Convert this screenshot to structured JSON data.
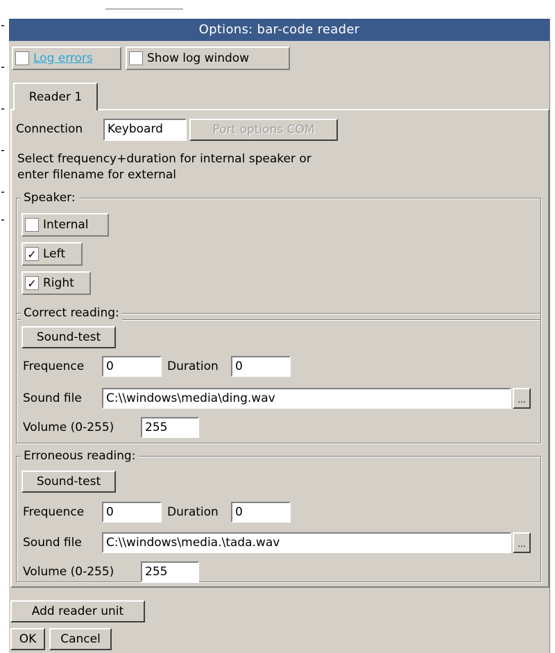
{
  "window": {
    "title": "Options: bar-code reader"
  },
  "options": {
    "log_errors": {
      "label": "Log errors",
      "checked": false
    },
    "show_log_window": {
      "label": "Show log window",
      "checked": false
    }
  },
  "tabs": [
    {
      "label": "Reader 1",
      "active": true
    }
  ],
  "reader": {
    "connection_label": "Connection",
    "connection_value": "Keyboard",
    "port_options_label": "Port options COM",
    "instructions_line1": "Select frequency+duration for internal speaker or",
    "instructions_line2": "enter filename for external",
    "speaker": {
      "title": "Speaker:",
      "internal": {
        "label": "Internal",
        "checked": false,
        "mark": ""
      },
      "left": {
        "label": "Left",
        "checked": true,
        "mark": "✓"
      },
      "right": {
        "label": "Right",
        "checked": true,
        "mark": "✓"
      }
    },
    "correct": {
      "title": "Correct reading:",
      "sound_test_label": "Sound-test",
      "frequence_label": "Frequence",
      "frequence_value": "0",
      "duration_label": "Duration",
      "duration_value": "0",
      "sound_file_label": "Sound file",
      "sound_file_value": "C:\\\\windows\\media\\ding.wav",
      "browse_label": "...",
      "volume_label": "Volume (0-255)",
      "volume_value": "255"
    },
    "erroneous": {
      "title": "Erroneous reading:",
      "sound_test_label": "Sound-test",
      "frequence_label": "Frequence",
      "frequence_value": "0",
      "duration_label": "Duration",
      "duration_value": "0",
      "sound_file_label": "Sound file",
      "sound_file_value": "C:\\\\windows\\media.\\tada.wav",
      "browse_label": "...",
      "volume_label": "Volume (0-255)",
      "volume_value": "255"
    }
  },
  "footer": {
    "add_reader_label": "Add reader unit",
    "ok_label": "OK",
    "cancel_label": "Cancel"
  },
  "colors": {
    "titlebar": "#3a5a8c",
    "dialog_bg": "#d4d0c8",
    "link_blue": "#2aa6d8"
  }
}
